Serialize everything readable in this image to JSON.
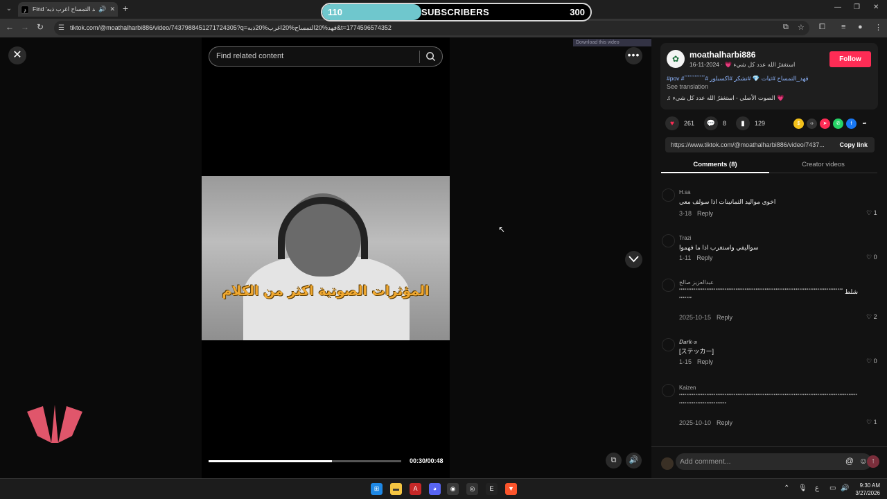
{
  "browser": {
    "tab_title": "Find 'فهد التمساح اغرب ذبه'",
    "tab_favicon": "tiktok-icon",
    "url": "tiktok.com/@moathalharbi886/video/7437988451271724305?q=فهد%20التمساح%20اغرب%20ذبه&t=1774596574352"
  },
  "subscribers_overlay": {
    "current": "110",
    "label": "SUBSCRIBERS",
    "goal": "300",
    "progress_fraction": 0.37
  },
  "player": {
    "search_placeholder": "Find related content",
    "download_tag": "Download this video",
    "caption": "المؤثرات الصوتية اكثر من الكلام",
    "time": "00:30/00:48",
    "progress_fraction": 0.64
  },
  "post": {
    "author": "moathalharbi886",
    "subline": "استغفرُ الله عدد كل شيء 💗 · 2024-11-16",
    "description": "#pov #فهد_التمساح #ثبات 💎 #تشكر #اكسبلور #ٴٴٴٴٴٴٴٴٴٴٴٴ",
    "see_translation": "See translation",
    "music": "الصوت الأصلي - استغفرُ الله عدد كل شيء 💗",
    "follow_label": "Follow",
    "likes": "261",
    "comments": "8",
    "saves": "129",
    "link": "https://www.tiktok.com/@moathalharbi886/video/7437...",
    "copy_link_label": "Copy link"
  },
  "tabs": {
    "comments": "Comments (8)",
    "creator": "Creator videos"
  },
  "comments": [
    {
      "user": "H.sa",
      "text": "اخوي مواليد الثمانينات اذا سولف معي",
      "date": "3-18",
      "likes": "1"
    },
    {
      "user": "Trazi",
      "text": "سواليفي واستغرب اذا ما فهموا",
      "date": "1-11",
      "likes": "0"
    },
    {
      "user": "عبدالعزيز صالح",
      "text": "شلط ٴٴٴٴٴٴٴٴٴٴٴٴٴٴٴٴٴٴٴٴٴٴٴٴٴٴٴٴٴٴٴٴٴٴٴٴٴٴٴٴٴٴٴٴٴٴٴٴٴٴٴٴٴٴٴٴٴٴٴٴٴٴٴٴٴٴٴٴٴٴٴٴٴٴٴٴٴٴٴٴٴٴٴٴٴٴٴٴٴٴٴٴٴٴٴٴٴ",
      "date": "2025-10-15",
      "likes": "2"
    },
    {
      "user": "𝑫𝒂𝒓𝒌-𝒔",
      "text": "[ステッカー]",
      "date": "1-15",
      "likes": "0"
    },
    {
      "user": "Kaizen",
      "text": "ٴٴٴٴٴٴٴٴٴٴٴٴٴٴٴٴٴٴٴٴٴٴٴٴٴٴٴٴٴٴٴٴٴٴٴٴٴٴٴٴٴٴٴٴٴٴٴٴٴٴٴٴٴٴٴٴٴٴٴٴٴٴٴٴٴٴٴٴٴٴٴٴٴٴٴٴٴٴٴٴٴٴٴٴٴٴٴٴٴٴٴٴٴٴٴٴٴٴٴٴٴٴٴٴٴٴٴٴٴٴٴٴٴٴٴٴٴٴٴٴٴٴٴٴ",
      "date": "2025-10-10",
      "likes": "1"
    }
  ],
  "reply_label": "Reply",
  "add_comment_placeholder": "Add comment...",
  "taskbar": {
    "lang": "ع",
    "time": "9:30 AM",
    "date": "3/27/2026"
  },
  "colors": {
    "accent": "#fe2c55",
    "subs_fill": "#6fc7cd",
    "caption": "#f0a830"
  }
}
